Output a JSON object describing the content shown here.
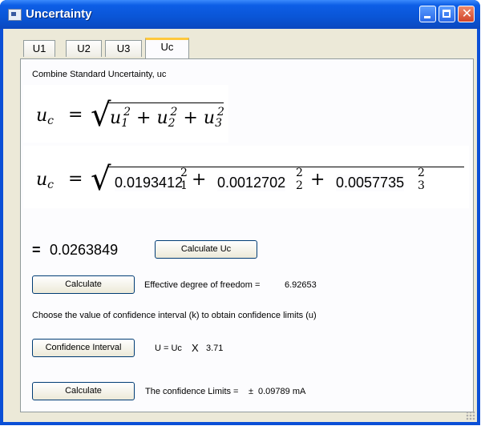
{
  "window": {
    "title": "Uncertainty"
  },
  "tabs": [
    {
      "label": "U1"
    },
    {
      "label": "U2"
    },
    {
      "label": "U3"
    },
    {
      "label": "Uc"
    }
  ],
  "panel": {
    "heading": "Combine Standard Uncertainty, uc",
    "formula_top": {
      "u": "u",
      "c": "c",
      "eq": "=",
      "u1": "u",
      "s1": "1",
      "p1": "2",
      "plus1": "+",
      "u2": "u",
      "s2": "2",
      "p2": "2",
      "plus2": "+",
      "u3": "u",
      "s3": "3",
      "p3": "2"
    },
    "formula_values": {
      "u": "u",
      "c": "c",
      "eq": "=",
      "v1": "0.0193412",
      "v2": "0.0012702",
      "v3": "0.0057735",
      "sup": "2",
      "s1": "1",
      "s2": "2",
      "s3": "3",
      "plus": "+"
    },
    "uc_prefix": "=",
    "uc_value": "0.0263849",
    "calc_uc_button": "Calculate Uc",
    "calculate_button_1": "Calculate",
    "dof_label": "Effective degree of freedom =",
    "dof_value": "6.92653",
    "choose_text": "Choose the value of confidence interval (k) to obtain confidence limits (u)",
    "confidence_button": "Confidence Interval",
    "u_formula": "U = Uc",
    "times": "X",
    "k_value": "3.71",
    "calculate_button_2": "Calculate",
    "limits_label": "The confidence Limits  =",
    "pm": "±",
    "limits_value": "0.09789 mA"
  },
  "colors": {
    "titlebar": "#0a55d6",
    "client": "#ece9d8",
    "panel": "#fcfcfe",
    "tab_highlight": "#ffc83c"
  }
}
